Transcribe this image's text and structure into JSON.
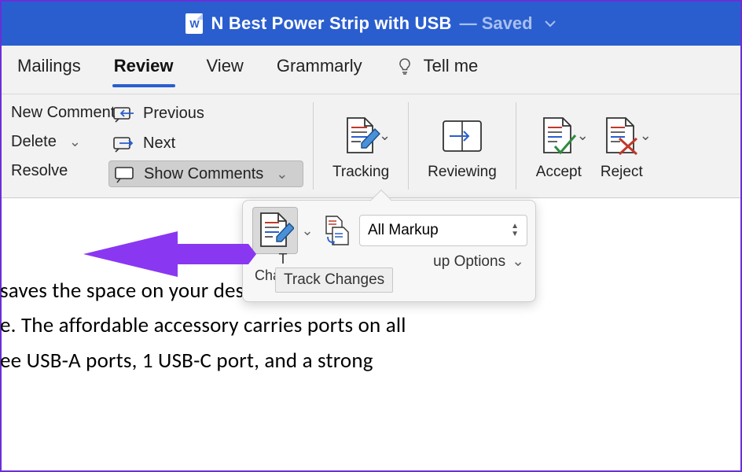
{
  "title": {
    "doc_name": "N Best Power Strip with USB",
    "status": "— Saved"
  },
  "tabs": {
    "items": [
      "Mailings",
      "Review",
      "View",
      "Grammarly",
      "Tell me"
    ],
    "active_index": 1
  },
  "ribbon": {
    "left1": {
      "new_comment": "New Comment",
      "delete": "Delete",
      "resolve": "Resolve"
    },
    "left2": {
      "previous": "Previous",
      "next": "Next",
      "show_comments": "Show Comments"
    },
    "big": {
      "tracking": "Tracking",
      "reviewing": "Reviewing",
      "accept": "Accept",
      "reject": "Reject"
    }
  },
  "flyout": {
    "track_label": "Track Changes",
    "track_small_lines": [
      "T",
      "Changes"
    ],
    "select_value": "All Markup",
    "options_label": "up Options",
    "tooltip": "Track Changes"
  },
  "document": {
    "l1": "saves the space on your desk but also offers",
    "l2": "e. The affordable accessory carries ports on all",
    "l3": "ee USB-A ports, 1 USB-C port, and a strong"
  },
  "colors": {
    "accent": "#2a5ecf",
    "arrow": "#8a37f2"
  }
}
